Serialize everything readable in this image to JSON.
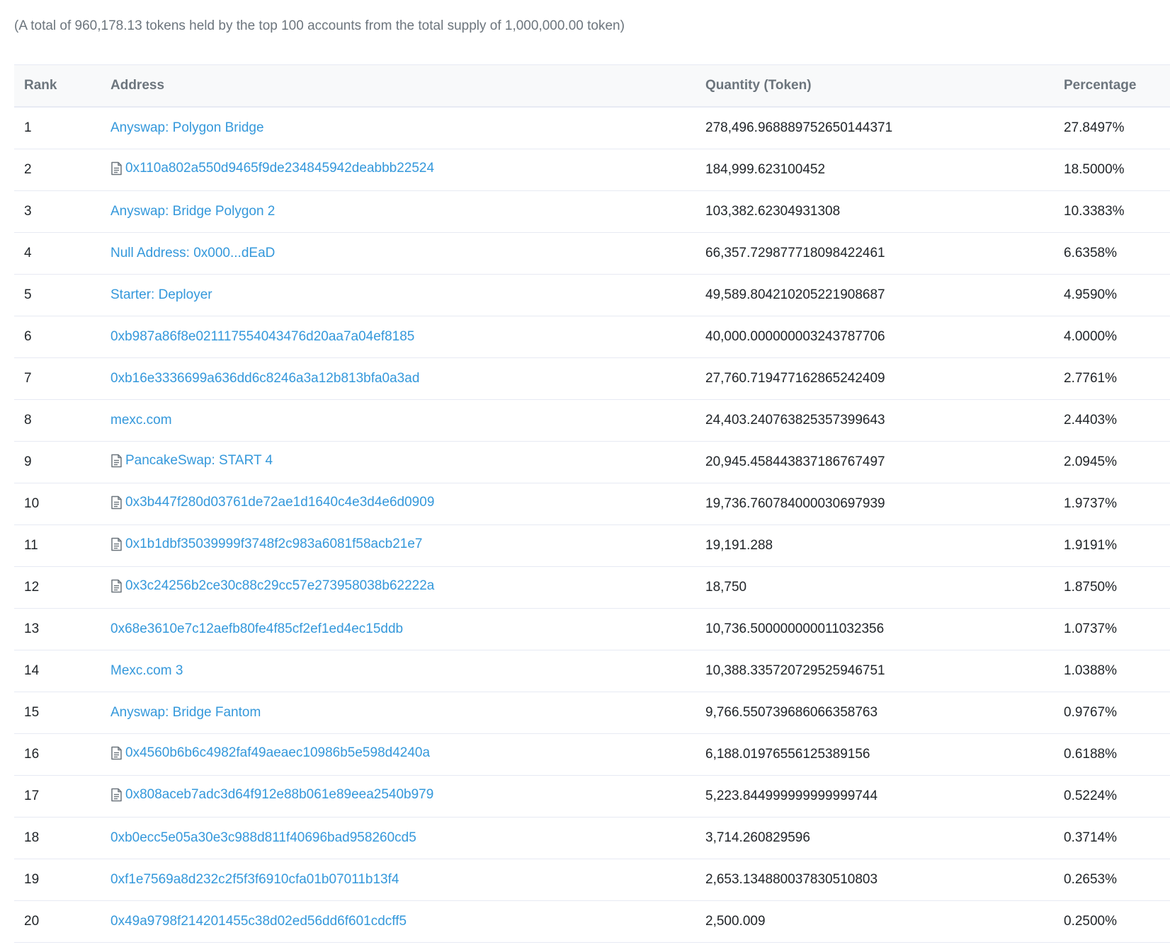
{
  "summary": "(A total of 960,178.13 tokens held by the top 100 accounts from the total supply of 1,000,000.00 token)",
  "table": {
    "headers": {
      "rank": "Rank",
      "address": "Address",
      "quantity": "Quantity (Token)",
      "percentage": "Percentage"
    },
    "rows": [
      {
        "rank": "1",
        "address": "Anyswap: Polygon Bridge",
        "contract": false,
        "quantity": "278,496.968889752650144371",
        "percentage": "27.8497%"
      },
      {
        "rank": "2",
        "address": "0x110a802a550d9465f9de234845942deabbb22524",
        "contract": true,
        "quantity": "184,999.623100452",
        "percentage": "18.5000%"
      },
      {
        "rank": "3",
        "address": "Anyswap: Bridge Polygon 2",
        "contract": false,
        "quantity": "103,382.62304931308",
        "percentage": "10.3383%"
      },
      {
        "rank": "4",
        "address": "Null Address: 0x000...dEaD",
        "contract": false,
        "quantity": "66,357.729877718098422461",
        "percentage": "6.6358%"
      },
      {
        "rank": "5",
        "address": "Starter: Deployer",
        "contract": false,
        "quantity": "49,589.804210205221908687",
        "percentage": "4.9590%"
      },
      {
        "rank": "6",
        "address": "0xb987a86f8e021117554043476d20aa7a04ef8185",
        "contract": false,
        "quantity": "40,000.000000003243787706",
        "percentage": "4.0000%"
      },
      {
        "rank": "7",
        "address": "0xb16e3336699a636dd6c8246a3a12b813bfa0a3ad",
        "contract": false,
        "quantity": "27,760.719477162865242409",
        "percentage": "2.7761%"
      },
      {
        "rank": "8",
        "address": "mexc.com",
        "contract": false,
        "quantity": "24,403.240763825357399643",
        "percentage": "2.4403%"
      },
      {
        "rank": "9",
        "address": "PancakeSwap: START 4",
        "contract": true,
        "quantity": "20,945.458443837186767497",
        "percentage": "2.0945%"
      },
      {
        "rank": "10",
        "address": "0x3b447f280d03761de72ae1d1640c4e3d4e6d0909",
        "contract": true,
        "quantity": "19,736.760784000030697939",
        "percentage": "1.9737%"
      },
      {
        "rank": "11",
        "address": "0x1b1dbf35039999f3748f2c983a6081f58acb21e7",
        "contract": true,
        "quantity": "19,191.288",
        "percentage": "1.9191%"
      },
      {
        "rank": "12",
        "address": "0x3c24256b2ce30c88c29cc57e273958038b62222a",
        "contract": true,
        "quantity": "18,750",
        "percentage": "1.8750%"
      },
      {
        "rank": "13",
        "address": "0x68e3610e7c12aefb80fe4f85cf2ef1ed4ec15ddb",
        "contract": false,
        "quantity": "10,736.500000000011032356",
        "percentage": "1.0737%"
      },
      {
        "rank": "14",
        "address": "Mexc.com 3",
        "contract": false,
        "quantity": "10,388.335720729525946751",
        "percentage": "1.0388%"
      },
      {
        "rank": "15",
        "address": "Anyswap: Bridge Fantom",
        "contract": false,
        "quantity": "9,766.550739686066358763",
        "percentage": "0.9767%"
      },
      {
        "rank": "16",
        "address": "0x4560b6b6c4982faf49aeaec10986b5e598d4240a",
        "contract": true,
        "quantity": "6,188.01976556125389156",
        "percentage": "0.6188%"
      },
      {
        "rank": "17",
        "address": "0x808aceb7adc3d64f912e88b061e89eea2540b979",
        "contract": true,
        "quantity": "5,223.844999999999999744",
        "percentage": "0.5224%"
      },
      {
        "rank": "18",
        "address": "0xb0ecc5e05a30e3c988d811f40696bad958260cd5",
        "contract": false,
        "quantity": "3,714.260829596",
        "percentage": "0.3714%"
      },
      {
        "rank": "19",
        "address": "0xf1e7569a8d232c2f5f3f6910cfa01b07011b13f4",
        "contract": false,
        "quantity": "2,653.134880037830510803",
        "percentage": "0.2653%"
      },
      {
        "rank": "20",
        "address": "0x49a9798f214201455c38d02ed56dd6f601cdcff5",
        "contract": false,
        "quantity": "2,500.009",
        "percentage": "0.2500%"
      }
    ]
  },
  "icons": {
    "contract": "contract-file-icon"
  },
  "colors": {
    "link": "#3498db",
    "muted": "#6c757d",
    "border": "#e7eaf3"
  }
}
